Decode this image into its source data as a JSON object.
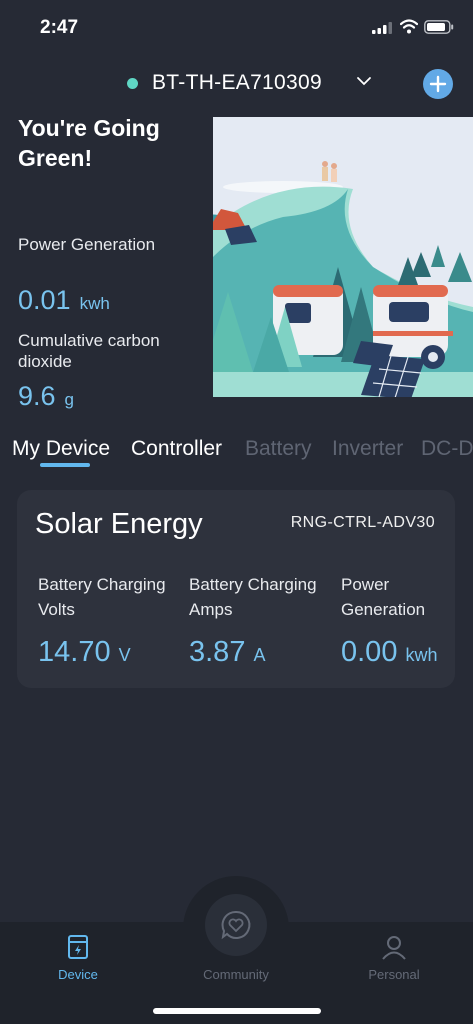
{
  "status_bar": {
    "time": "2:47"
  },
  "device_selector": {
    "name": "BT-TH-EA710309"
  },
  "summary": {
    "headline": "You're Going Green!",
    "power_generation": {
      "label": "Power Generation",
      "value": "0.01",
      "unit": "kwh"
    },
    "carbon": {
      "label": "Cumulative carbon dioxide",
      "value": "9.6",
      "unit": "g"
    }
  },
  "tabs": [
    "My Device",
    "Controller",
    "Battery",
    "Inverter",
    "DC-D"
  ],
  "device_card": {
    "title": "Solar Energy",
    "model": "RNG-CTRL-ADV30",
    "metrics": [
      {
        "label": "Battery Charging Volts",
        "value": "14.70",
        "unit": "V"
      },
      {
        "label": "Battery Charging Amps",
        "value": "3.87",
        "unit": "A"
      },
      {
        "label": "Power Generation",
        "value": "0.00",
        "unit": "kwh"
      }
    ]
  },
  "bottom_nav": {
    "items": [
      {
        "label": "Device",
        "icon": "device-icon",
        "active": true
      },
      {
        "label": "Community",
        "icon": "heart-chat-icon",
        "active": false
      },
      {
        "label": "Personal",
        "icon": "person-icon",
        "active": false
      }
    ]
  },
  "colors": {
    "accent": "#62a9e6",
    "value": "#79c3ee",
    "status_dot": "#5fd6c4",
    "background": "#262a35"
  }
}
